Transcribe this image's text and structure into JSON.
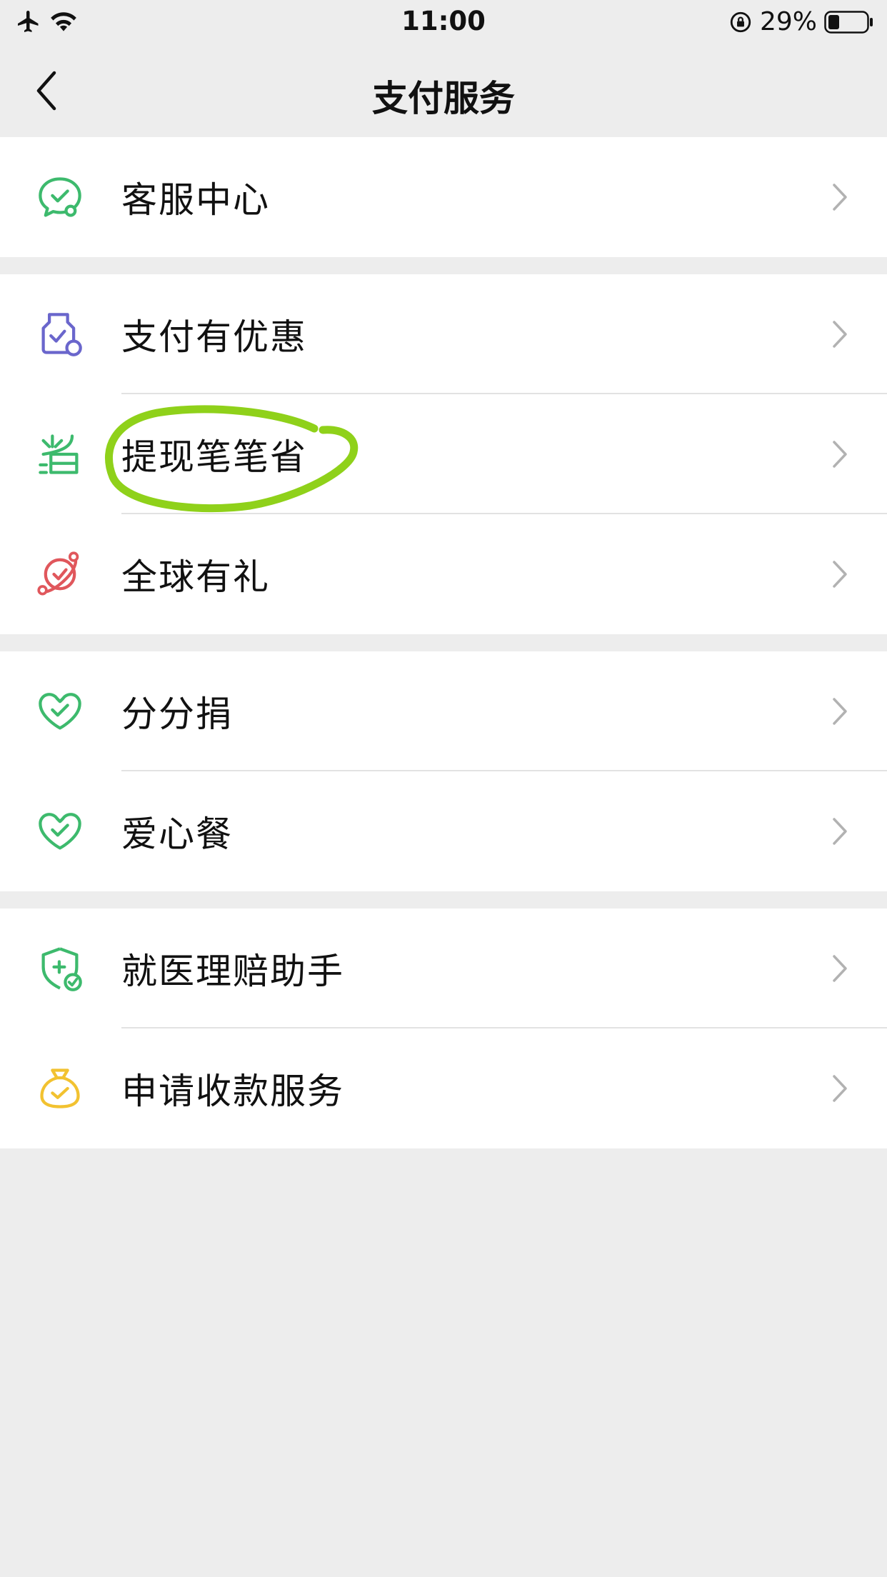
{
  "status_bar": {
    "time": "11:00",
    "battery_percent": "29%"
  },
  "nav": {
    "title": "支付服务"
  },
  "groups": [
    {
      "items": [
        {
          "label": "客服中心",
          "icon": "customer-service-icon",
          "color": "#3dba6d"
        }
      ]
    },
    {
      "items": [
        {
          "label": "支付有优惠",
          "icon": "discount-icon",
          "color": "#6a66cc"
        },
        {
          "label": "提现笔笔省",
          "icon": "withdraw-save-icon",
          "color": "#3dba6d"
        },
        {
          "label": "全球有礼",
          "icon": "global-gift-icon",
          "color": "#e0575c"
        }
      ]
    },
    {
      "items": [
        {
          "label": "分分捐",
          "icon": "heart-check-icon",
          "color": "#3dba6d"
        },
        {
          "label": "爱心餐",
          "icon": "heart-check-icon",
          "color": "#3dba6d"
        }
      ]
    },
    {
      "items": [
        {
          "label": "就医理赔助手",
          "icon": "medical-claim-icon",
          "color": "#3dba6d"
        },
        {
          "label": "申请收款服务",
          "icon": "money-bag-icon",
          "color": "#f2c230"
        }
      ]
    }
  ],
  "colors": {
    "background": "#ededed",
    "card": "#ffffff",
    "highlight": "#8fd11a",
    "chevron": "#b2b2b2"
  }
}
